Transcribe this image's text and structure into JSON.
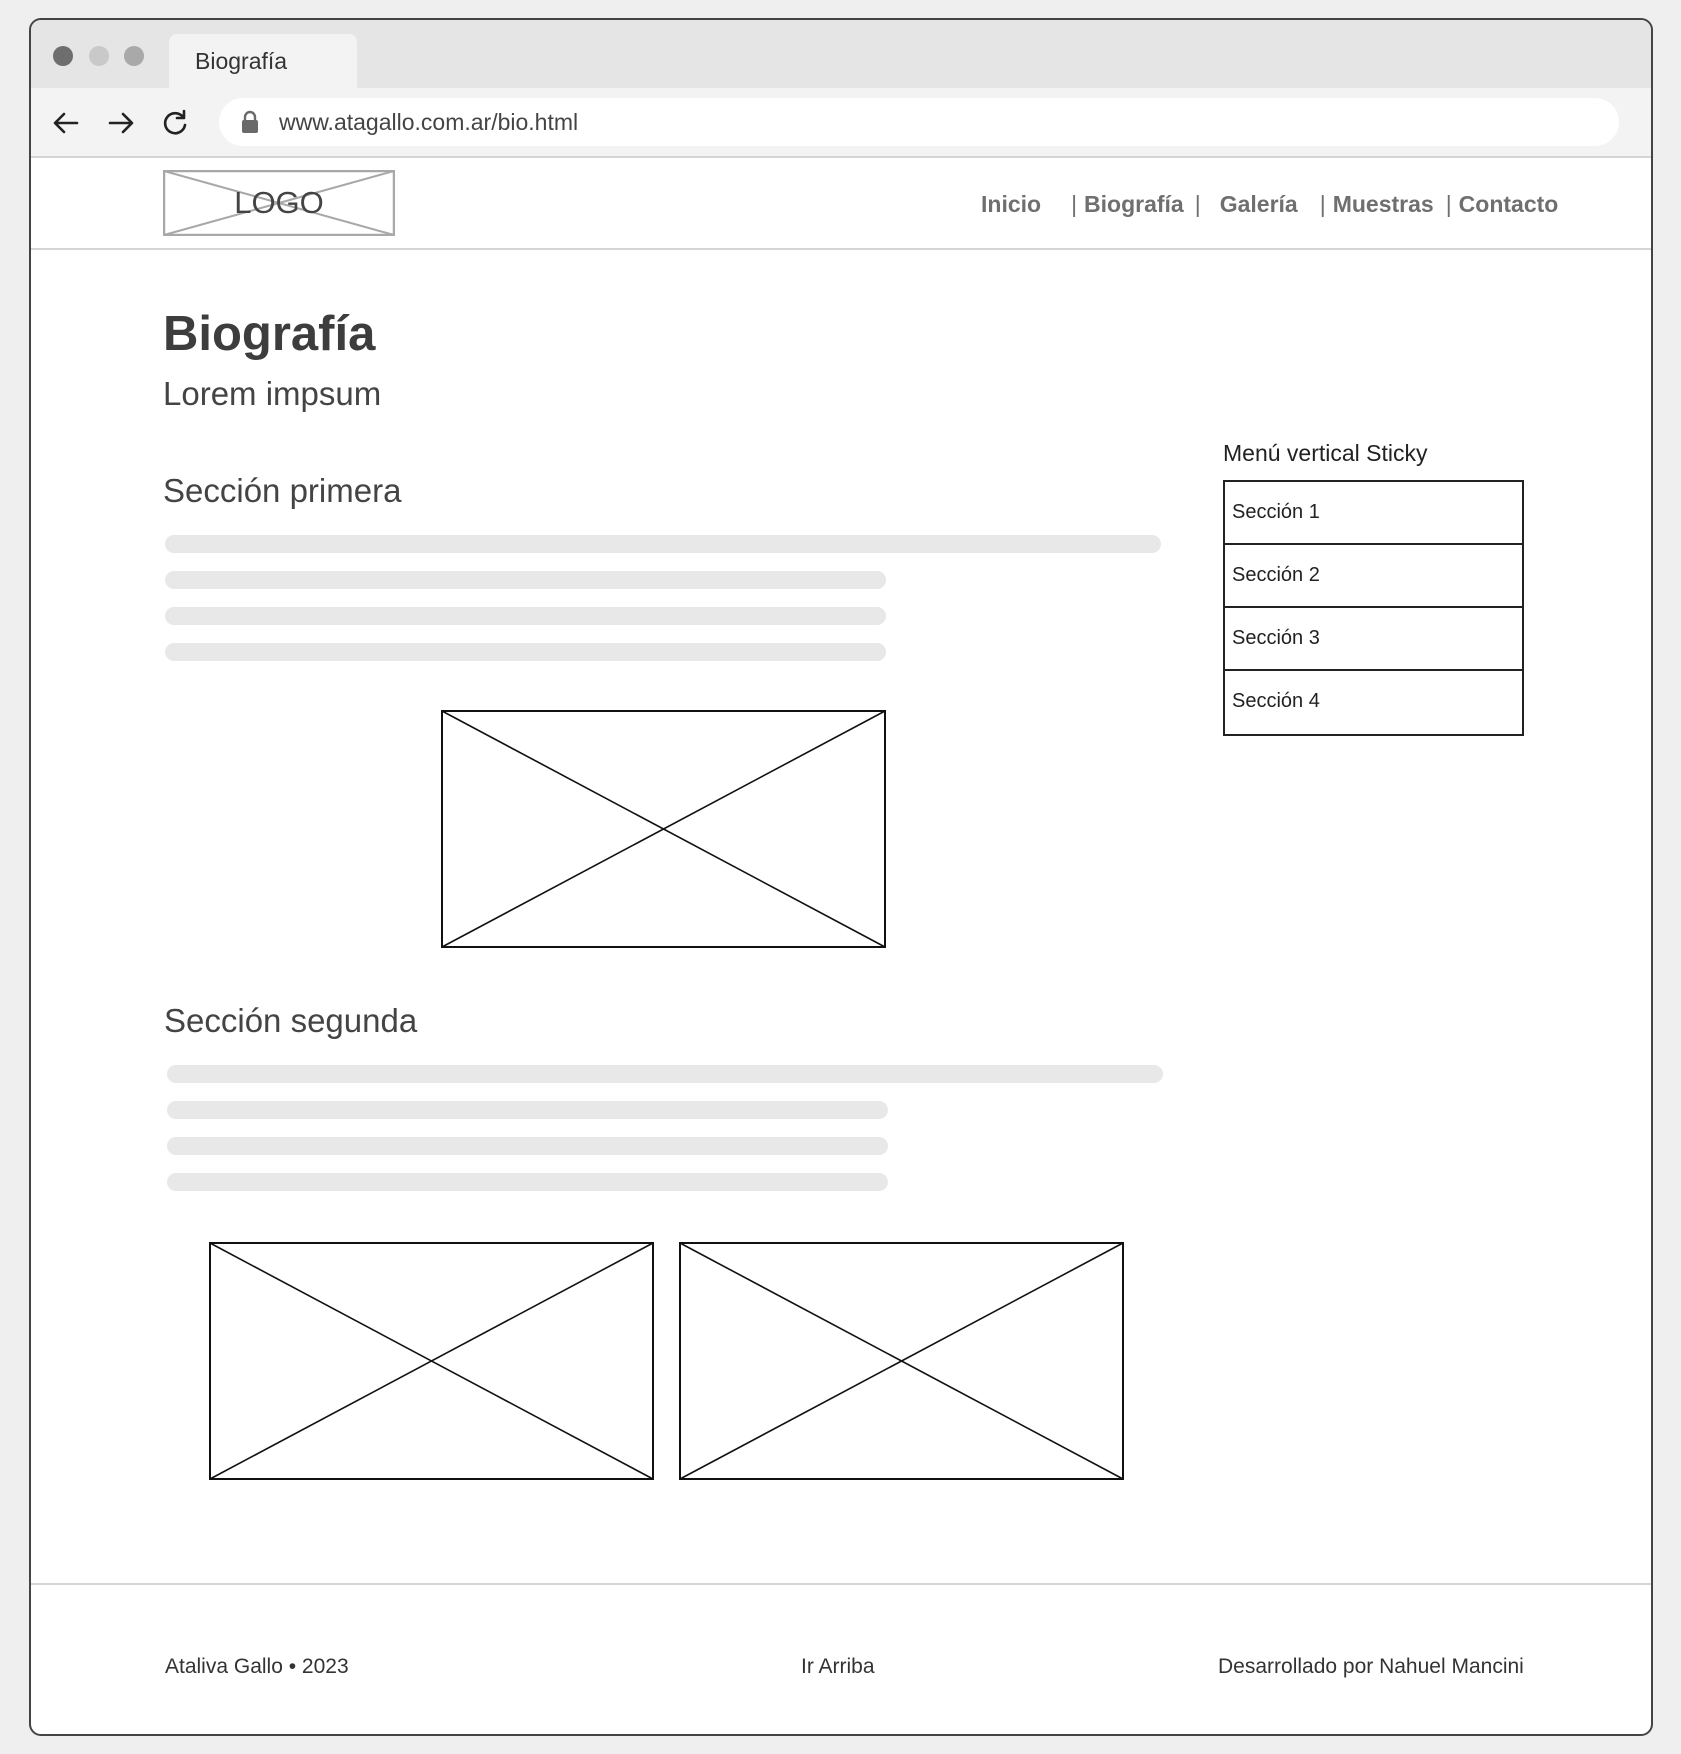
{
  "browser": {
    "tab_title": "Biografía",
    "url": "www.atagallo.com.ar/bio.html"
  },
  "site": {
    "logo_label": "LOGO",
    "nav": [
      {
        "label": "Inicio"
      },
      {
        "label": "Biografía"
      },
      {
        "label": "Galería"
      },
      {
        "label": "Muestras"
      },
      {
        "label": "Contacto"
      }
    ],
    "nav_separator": "|"
  },
  "page": {
    "title": "Biografía",
    "subtitle": "Lorem impsum",
    "sections": [
      {
        "heading": "Sección primera"
      },
      {
        "heading": "Sección segunda"
      }
    ]
  },
  "sidebar": {
    "title": "Menú vertical Sticky",
    "items": [
      {
        "label": "Sección 1"
      },
      {
        "label": "Sección 2"
      },
      {
        "label": "Sección 3"
      },
      {
        "label": "Sección 4"
      }
    ]
  },
  "footer": {
    "left": "Ataliva Gallo • 2023",
    "center": "Ir Arriba",
    "right": "Desarrollado por Nahuel Mancini"
  }
}
